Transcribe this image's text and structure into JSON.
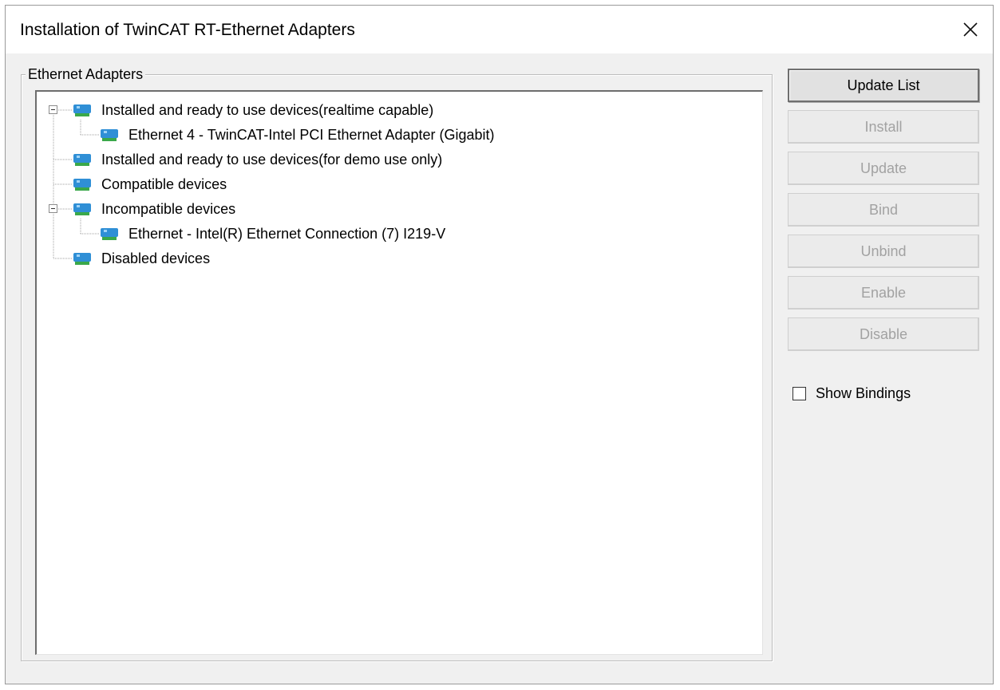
{
  "window": {
    "title": "Installation of TwinCAT RT-Ethernet Adapters"
  },
  "group": {
    "label": "Ethernet Adapters"
  },
  "tree": [
    {
      "label": "Installed and ready to use devices(realtime capable)",
      "expanded": true
    },
    {
      "label": "Ethernet 4 - TwinCAT-Intel PCI Ethernet Adapter (Gigabit)",
      "child": true
    },
    {
      "label": "Installed and ready to use devices(for demo use only)"
    },
    {
      "label": "Compatible devices"
    },
    {
      "label": "Incompatible devices",
      "expanded": true
    },
    {
      "label": "Ethernet - Intel(R) Ethernet Connection (7) I219-V",
      "child": true
    },
    {
      "label": "Disabled devices"
    }
  ],
  "buttons": {
    "update_list": "Update List",
    "install": "Install",
    "update": "Update",
    "bind": "Bind",
    "unbind": "Unbind",
    "enable": "Enable",
    "disable": "Disable"
  },
  "show_bindings": {
    "label": "Show Bindings",
    "checked": false
  },
  "colors": {
    "icon_blue": "#2f8fd6",
    "icon_green": "#3aa84a",
    "disabled_text": "#a2a2a2"
  },
  "icons": {
    "close": "close-icon",
    "network_adapter": "network-adapter-icon"
  }
}
